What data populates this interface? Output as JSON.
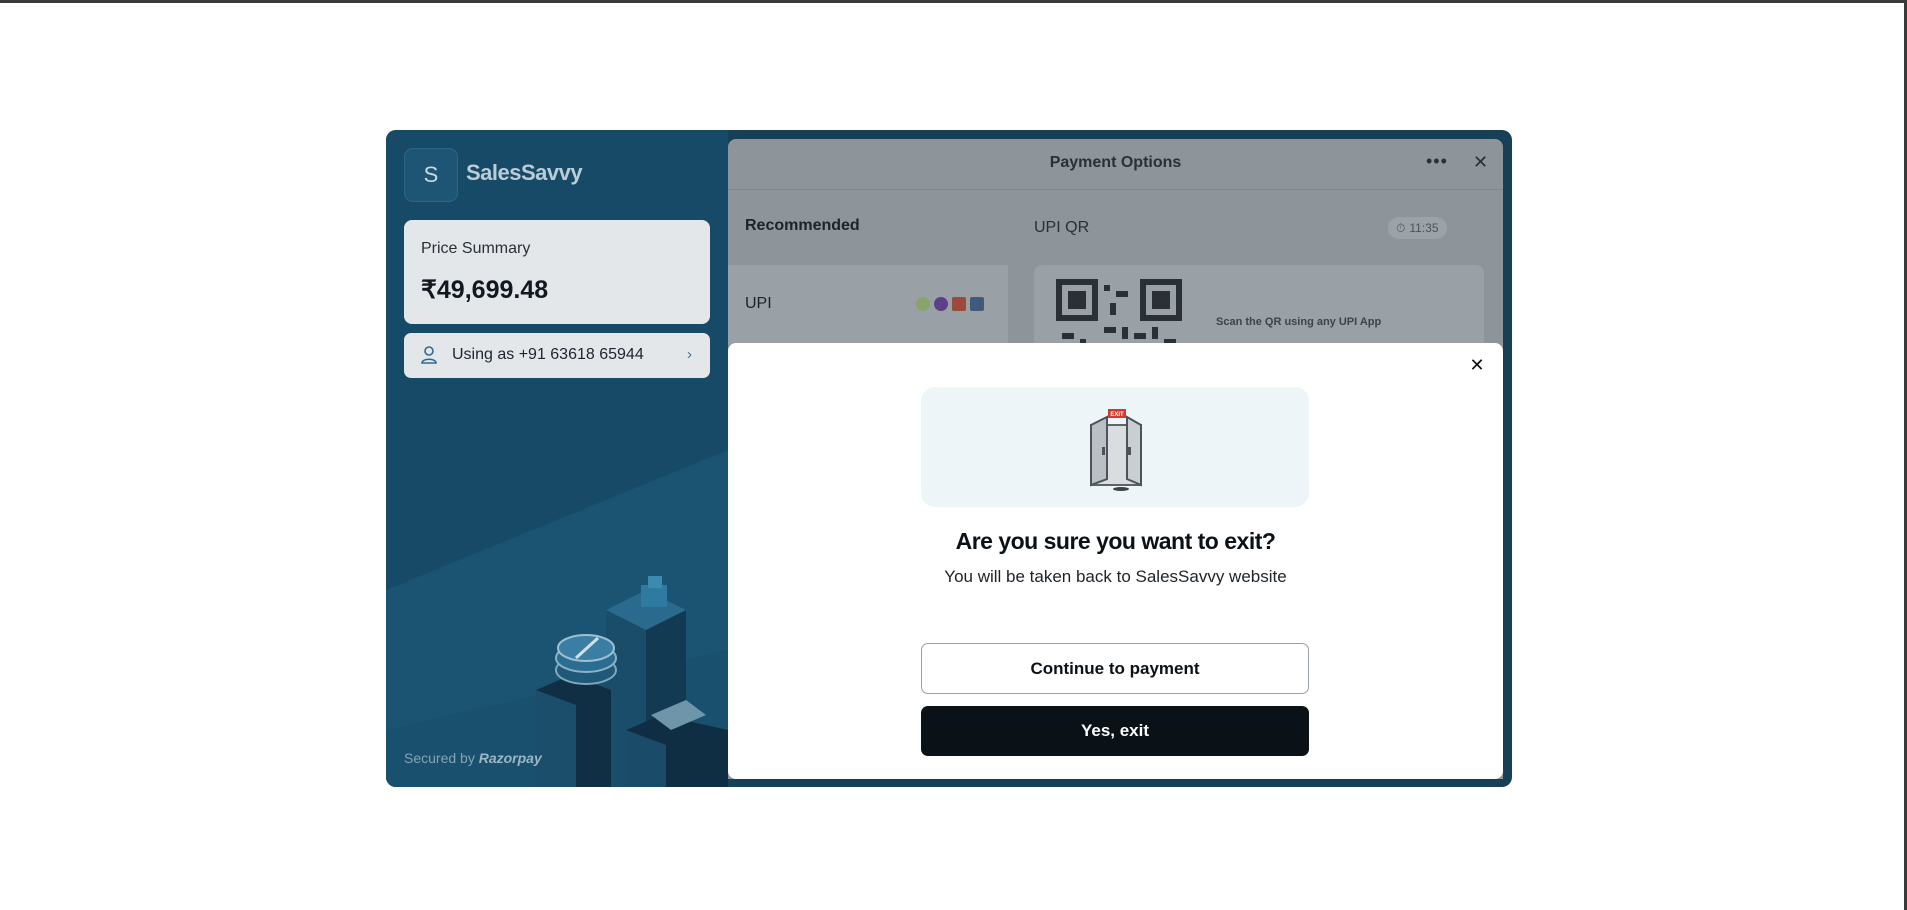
{
  "brand": {
    "logo_letter": "S",
    "name": "SalesSavvy"
  },
  "price_summary": {
    "label": "Price Summary",
    "amount": "₹49,699.48"
  },
  "user": {
    "text": "Using as +91 63618 65944"
  },
  "footer": {
    "secured_prefix": "Secured by",
    "provider": "Razorpay"
  },
  "payment_panel": {
    "title": "Payment Options",
    "section_title": "Recommended",
    "method_label": "UPI",
    "qr_title": "UPI QR",
    "timer": "11:35",
    "scan_text": "Scan the QR using any UPI App"
  },
  "exit_modal": {
    "heading": "Are you sure you want to exit?",
    "subtext": "You will be taken back to SalesSavvy website",
    "continue_label": "Continue to payment",
    "exit_label": "Yes, exit",
    "sign_text": "EXIT"
  },
  "colors": {
    "brand_panel": "#164a66",
    "primary_button": "#0b1217",
    "overlay_dim": "#8d949a"
  }
}
